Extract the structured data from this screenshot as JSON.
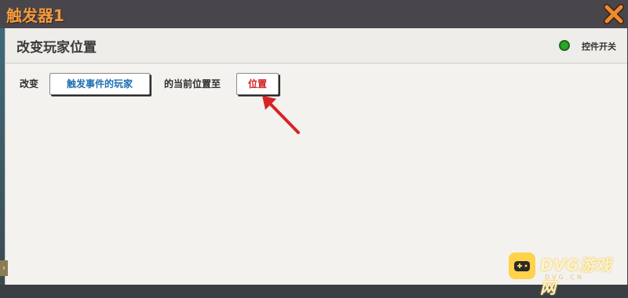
{
  "window": {
    "title": "触发器1"
  },
  "panel": {
    "title": "改变玩家位置",
    "toggle_label": "控件开关",
    "toggle_on": true,
    "row": {
      "prefix": "改变",
      "target_chip": "触发事件的玩家",
      "middle": "的当前位置至",
      "position_chip": "位置"
    }
  },
  "side_tab": {
    "label": "›"
  },
  "watermark": {
    "text": "DVG游戏网",
    "sub": "DVG.CN"
  },
  "colors": {
    "title_orange": "#f49b3c",
    "close_orange": "#ef8a2e",
    "toggle_green": "#2da52a",
    "chip_blue": "#1f6fb2",
    "chip_red": "#d31e1e",
    "arrow_red": "#d62424"
  },
  "icons": {
    "close": "close-x-icon",
    "arrow": "annotation-arrow-icon"
  }
}
